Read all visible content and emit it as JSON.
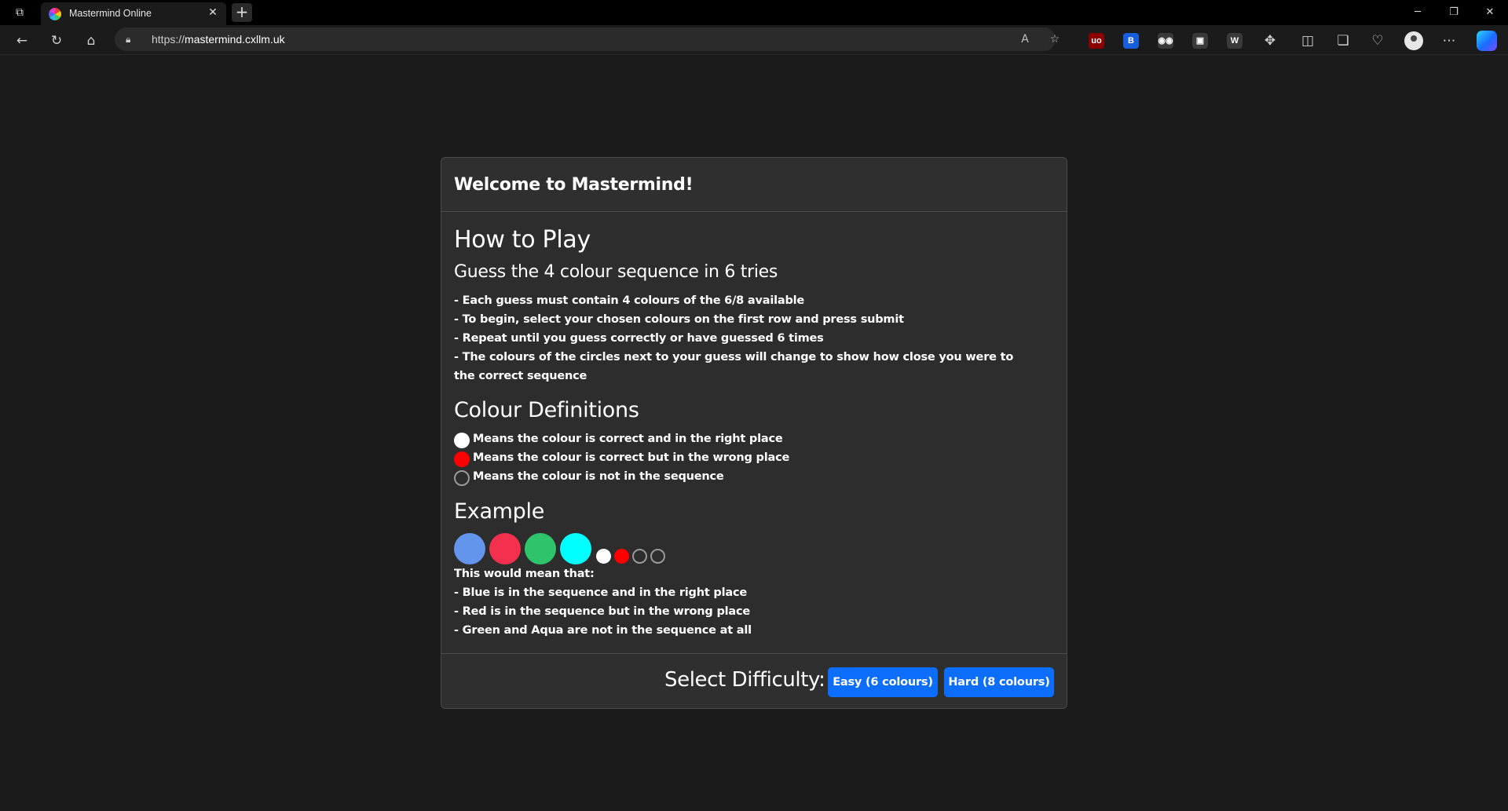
{
  "browser": {
    "tab_title": "Mastermind Online",
    "url_scheme": "https://",
    "url_host": "mastermind.cxllm.uk",
    "window_controls": {
      "minimize": "─",
      "restore": "❐",
      "close": "✕"
    },
    "extensions": [
      {
        "name": "ublock-icon",
        "label": "uo",
        "color": "#8b0000"
      },
      {
        "name": "bitwarden-icon",
        "label": "B",
        "color": "#175ddc"
      },
      {
        "name": "glasses-extension-icon",
        "label": "◉◉",
        "color": "#3a3a3a"
      },
      {
        "name": "tab-extension-icon",
        "label": "▣",
        "color": "#3a3a3a"
      },
      {
        "name": "w-extension-icon",
        "label": "W",
        "color": "#3a3a3a"
      }
    ]
  },
  "card": {
    "header_title": "Welcome to Mastermind!",
    "how_to_play": "How to Play",
    "subtitle": "Guess the 4 colour sequence in 6 tries",
    "rules": [
      "- Each guess must contain 4 colours of the 6/8 available",
      "- To begin, select your chosen colours on the first row and press submit",
      "- Repeat until you guess correctly or have guessed 6 times",
      "- The colours of the circles next to your guess will change to show how close you were to the correct sequence"
    ],
    "definitions_title": "Colour Definitions",
    "definitions": [
      {
        "text": "Means the colour is correct and in the right place",
        "color": "#ffffff"
      },
      {
        "text": "Means the colour is correct but in the wrong place",
        "color": "#ff0000"
      },
      {
        "text": "Means the colour is not in the sequence",
        "color": "none"
      }
    ],
    "example_title": "Example",
    "example_pegs": [
      "#6495ed",
      "#f5304f",
      "#2ec46b",
      "#00ffff"
    ],
    "example_feedback": [
      "#ffffff",
      "#ff0000",
      "none",
      "none"
    ],
    "example_lines": [
      "This would mean that:",
      "- Blue is in the sequence and in the right place",
      "- Red is in the sequence but in the wrong place",
      "- Green and Aqua are not in the sequence at all"
    ],
    "difficulty_label": "Select Difficulty:",
    "easy_button": "Easy (6 colours)",
    "hard_button": "Hard (8 colours)"
  },
  "colors": {
    "background": "#1b1b1b",
    "card": "#2d2d2d",
    "accent": "#0d6efd"
  }
}
